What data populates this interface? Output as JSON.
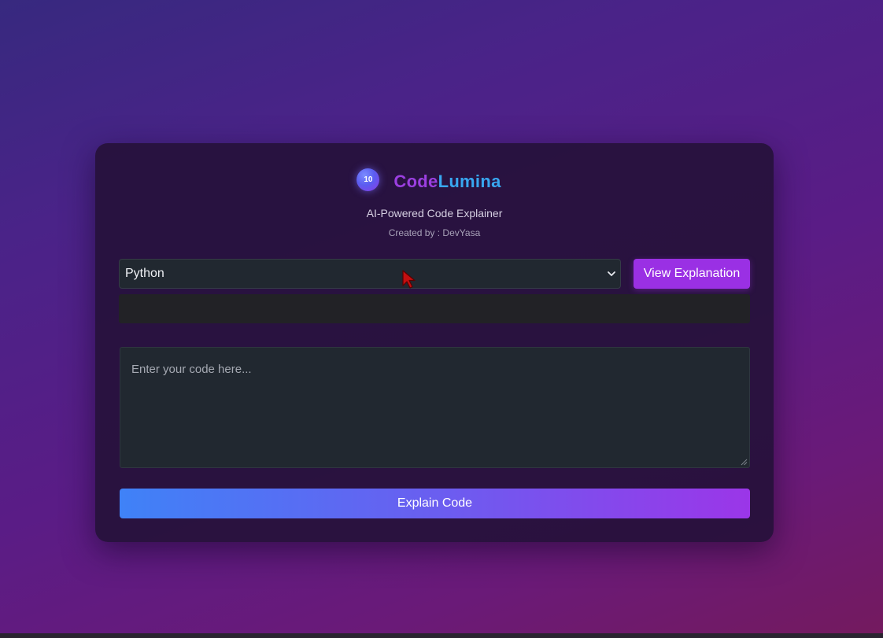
{
  "brand": {
    "logo_text": "10",
    "name_part1": "Code",
    "name_part2": "Lumina",
    "subtitle": "AI-Powered Code Explainer",
    "credit": "Created by : DevYasa"
  },
  "language_select": {
    "selected": "Python"
  },
  "buttons": {
    "view_explanation": "View Explanation",
    "explain_code": "Explain Code"
  },
  "code_input": {
    "placeholder": "Enter your code here..."
  },
  "colors": {
    "accent_purple": "#9a30e4",
    "accent_blue": "#3f82f7",
    "brand_code": "#9b3fe0",
    "brand_lumina": "#38a7f0",
    "card_bg": "#26113a"
  },
  "icons": {
    "select_chevron": "chevron-down-icon",
    "mouse_cursor": "cursor-icon",
    "resize_grip": "resize-grip-icon"
  }
}
